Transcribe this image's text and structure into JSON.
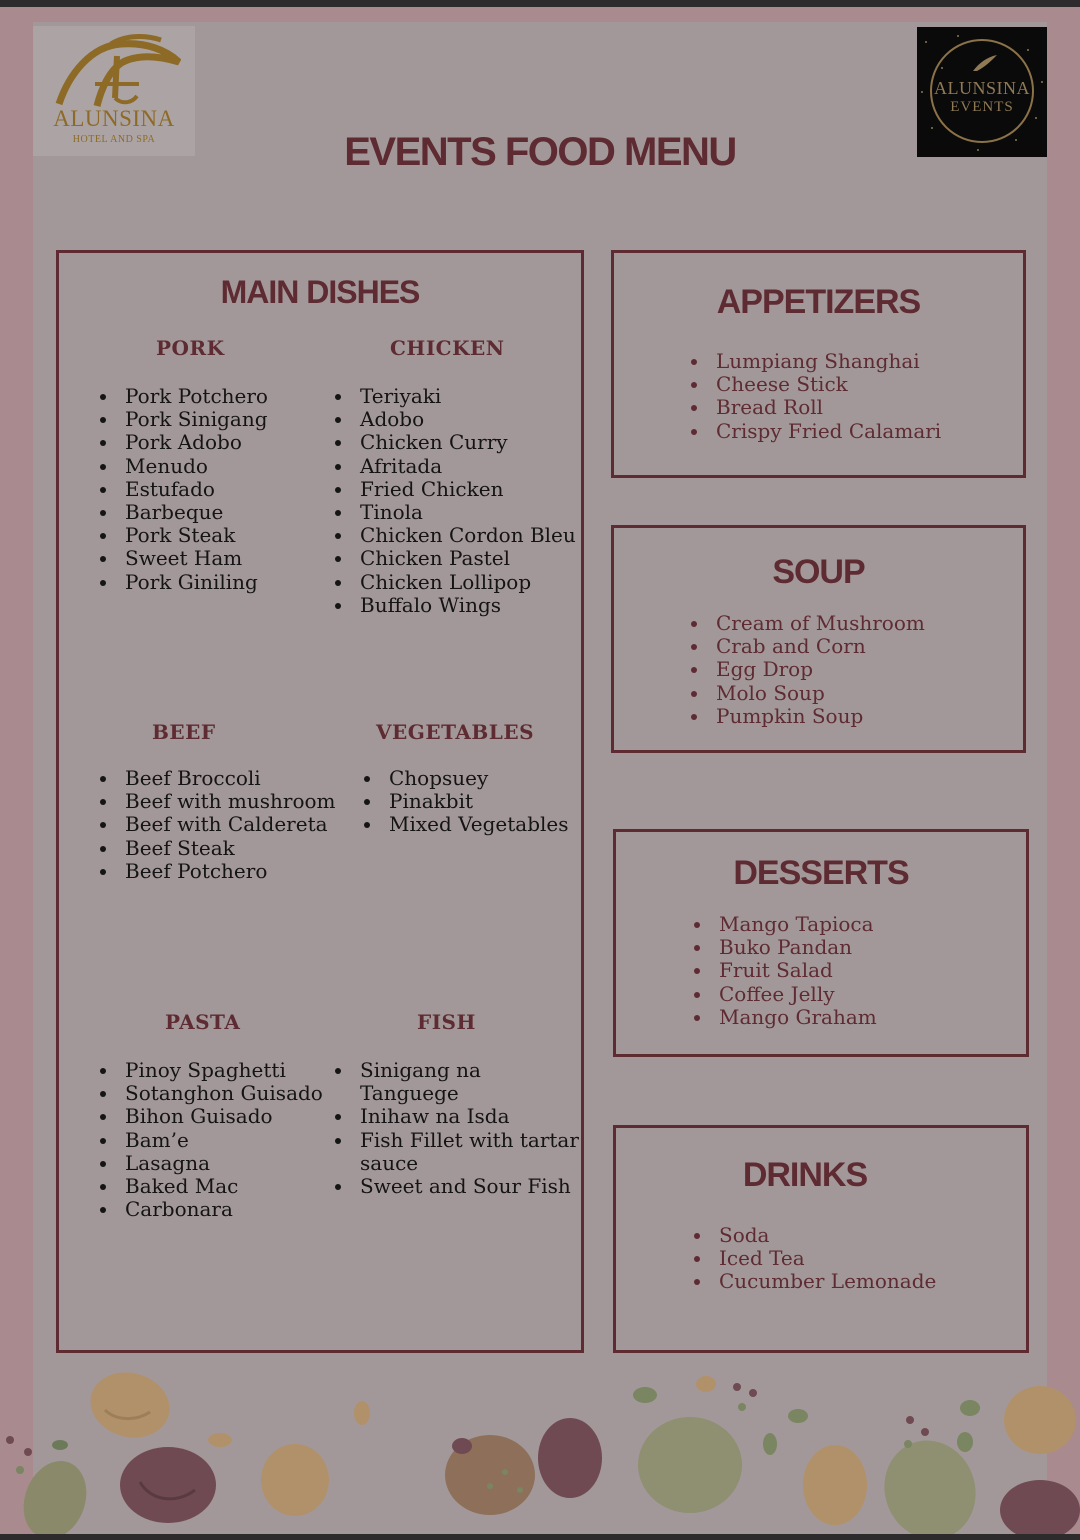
{
  "header": {
    "title": "EVENTS FOOD MENU",
    "logo_left": {
      "name": "ALUNSINA",
      "tagline": "HOTEL AND SPA"
    },
    "logo_right": {
      "line1": "ALUNSINA",
      "line2": "EVENTS"
    }
  },
  "main_dishes": {
    "title": "MAIN DISHES",
    "pork": {
      "title": "PORK",
      "items": [
        "Pork Potchero",
        "Pork Sinigang",
        "Pork Adobo",
        "Menudo",
        "Estufado",
        "Barbeque",
        "Pork Steak",
        "Sweet Ham",
        "Pork Giniling"
      ]
    },
    "chicken": {
      "title": "CHICKEN",
      "items": [
        "Teriyaki",
        "Adobo",
        "Chicken Curry",
        "Afritada",
        "Fried Chicken",
        "Tinola",
        "Chicken Cordon Bleu",
        "Chicken Pastel",
        "Chicken Lollipop",
        "Buffalo Wings"
      ]
    },
    "beef": {
      "title": "BEEF",
      "items": [
        "Beef Broccoli",
        "Beef with mushroom",
        "Beef with Caldereta",
        "Beef Steak",
        "Beef Potchero"
      ]
    },
    "vegetables": {
      "title": "VEGETABLES",
      "items": [
        "Chopsuey",
        "Pinakbit",
        "Mixed Vegetables"
      ]
    },
    "pasta": {
      "title": "PASTA",
      "items": [
        "Pinoy Spaghetti",
        "Sotanghon Guisado",
        "Bihon Guisado",
        "Bam’e",
        "Lasagna",
        "Baked Mac",
        "Carbonara"
      ]
    },
    "fish": {
      "title": "FISH",
      "items": [
        "Sinigang na Tanguege",
        "Inihaw na Isda",
        "Fish Fillet with tartar sauce",
        "Sweet and Sour Fish"
      ]
    }
  },
  "appetizers": {
    "title": "APPETIZERS",
    "items": [
      "Lumpiang Shanghai",
      "Cheese Stick",
      "Bread Roll",
      "Crispy Fried Calamari"
    ]
  },
  "soup": {
    "title": "SOUP",
    "items": [
      "Cream of Mushroom",
      "Crab and Corn",
      "Egg Drop",
      "Molo Soup",
      "Pumpkin Soup"
    ]
  },
  "desserts": {
    "title": "DESSERTS",
    "items": [
      "Mango Tapioca",
      "Buko Pandan",
      "Fruit Salad",
      "Coffee Jelly",
      "Mango Graham"
    ]
  },
  "drinks": {
    "title": "DRINKS",
    "items": [
      "Soda",
      "Iced Tea",
      "Cucumber Lemonade"
    ]
  },
  "colors": {
    "accent": "#5e2b32",
    "page": "#a39899",
    "gold": "#8d6a26"
  }
}
